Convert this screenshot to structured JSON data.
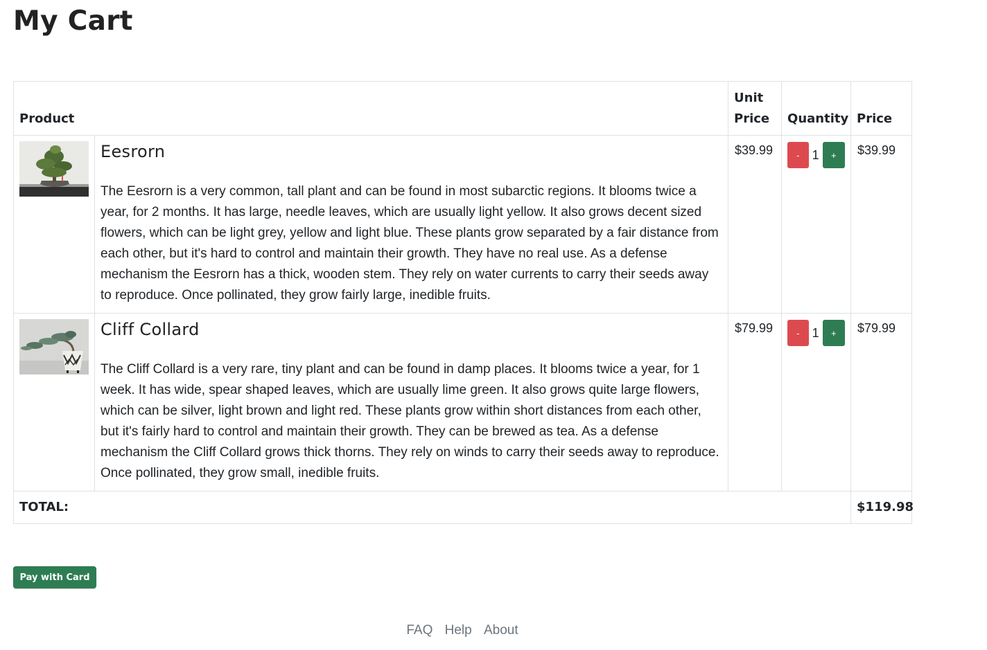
{
  "page": {
    "title": "My Cart"
  },
  "table": {
    "headers": {
      "product": "Product",
      "unit_price": "Unit Price",
      "quantity": "Quantity",
      "price": "Price"
    },
    "items": [
      {
        "name": "Eesrorn",
        "description": "The Eesrorn is a very common, tall plant and can be found in most subarctic regions. It blooms twice a year, for 2 months. It has large, needle leaves, which are usually light yellow. It also grows decent sized flowers, which can be light grey, yellow and light blue. These plants grow separated by a fair distance from each other, but it's hard to control and maintain their growth. They have no real use. As a defense mechanism the Eesrorn has a thick, wooden stem. They rely on water currents to carry their seeds away to reproduce. Once pollinated, they grow fairly large, inedible fruits.",
        "unit_price": "$39.99",
        "quantity": "1",
        "price": "$39.99",
        "image": "bonsai-tree-photo"
      },
      {
        "name": "Cliff Collard",
        "description": "The Cliff Collard is a very rare, tiny plant and can be found in damp places. It blooms twice a year, for 1 week. It has wide, spear shaped leaves, which are usually lime green. It also grows quite large flowers, which can be silver, light brown and light red. These plants grow within short distances from each other, but it's fairly hard to control and maintain their growth. They can be brewed as tea. As a defense mechanism the Cliff Collard grows thick thorns. They rely on winds to carry their seeds away to reproduce. Once pollinated, they grow small, inedible fruits.",
        "unit_price": "$79.99",
        "quantity": "1",
        "price": "$79.99",
        "image": "cascade-bonsai-pot-photo"
      }
    ],
    "minus_label": "-",
    "plus_label": "+",
    "total_label": "TOTAL:",
    "total_value": "$119.98"
  },
  "actions": {
    "pay_label": "Pay with Card"
  },
  "footer": {
    "links": [
      "FAQ",
      "Help",
      "About"
    ]
  },
  "colors": {
    "minus": "#dc4a4f",
    "plus": "#2e7d52",
    "pay": "#2e7d52",
    "footer_link": "#6c757d"
  }
}
